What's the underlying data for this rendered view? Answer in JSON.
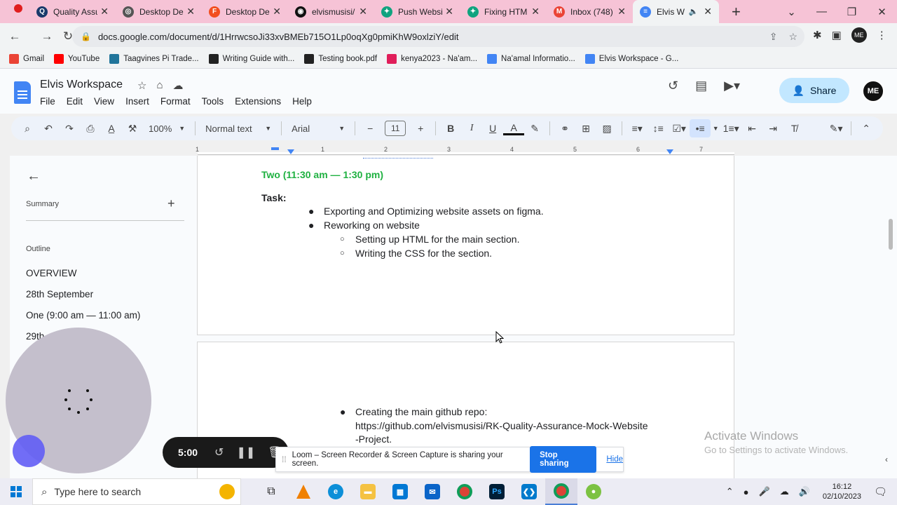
{
  "browser": {
    "tabs": [
      {
        "label": "Quality Assu",
        "color": "#1a3a6b",
        "glyph": "Q"
      },
      {
        "label": "Desktop De",
        "color": "#555",
        "glyph": "◎"
      },
      {
        "label": "Desktop De",
        "color": "#f24e1e",
        "glyph": "F"
      },
      {
        "label": "elvismusisi/",
        "color": "#111",
        "glyph": "◉"
      },
      {
        "label": "Push Websi",
        "color": "#10a37f",
        "glyph": "✦"
      },
      {
        "label": "Fixing HTM",
        "color": "#10a37f",
        "glyph": "✦"
      },
      {
        "label": "Inbox (748)",
        "color": "#ea4335",
        "glyph": "M"
      },
      {
        "label": "Elvis W",
        "color": "#4285f4",
        "glyph": "≡"
      }
    ],
    "url": "docs.google.com/document/d/1HrrwcsoJi33xvBMEb715O1Lp0oqXg0pmiKhW9oxlziY/edit",
    "bookmarks": [
      {
        "label": "Gmail",
        "color": "#ea4335"
      },
      {
        "label": "YouTube",
        "color": "#ff0000"
      },
      {
        "label": "Taagvines Pi Trade...",
        "color": "#21759b"
      },
      {
        "label": "Writing Guide with...",
        "color": "#222222"
      },
      {
        "label": "Testing book.pdf",
        "color": "#222222"
      },
      {
        "label": "kenya2023 - Na'am...",
        "color": "#e01e5a"
      },
      {
        "label": "Na'amal Informatio...",
        "color": "#4285f4"
      },
      {
        "label": "Elvis Workspace - G...",
        "color": "#4285f4"
      }
    ]
  },
  "docs": {
    "title": "Elvis Workspace",
    "menu": [
      "File",
      "Edit",
      "View",
      "Insert",
      "Format",
      "Tools",
      "Extensions",
      "Help"
    ],
    "share_label": "Share",
    "avatar_initials": "ME",
    "toolbar": {
      "zoom": "100%",
      "style": "Normal text",
      "font": "Arial",
      "font_size": "11"
    },
    "ruler_numbers": [
      "1",
      "1",
      "2",
      "3",
      "4",
      "5",
      "6",
      "7"
    ]
  },
  "outline": {
    "summary_label": "Summary",
    "outline_label": "Outline",
    "items": [
      "OVERVIEW",
      "28th September",
      "One (9:00 am — 11:00 am)",
      "29th"
    ]
  },
  "page1": {
    "heading": "Two (11:30 am — 1:30 pm)",
    "task_label": "Task:",
    "bullets": [
      "Exporting and Optimizing website assets on figma.",
      "Reworking on website"
    ],
    "sub_bullets": [
      "Setting up HTML for the main section.",
      "Writing the CSS for the section."
    ]
  },
  "page2": {
    "bullet_lines": [
      "Creating the main github repo:",
      "https://github.com/elvismusisi/RK-Quality-Assurance-Mock-Website",
      "-Project."
    ]
  },
  "loom": {
    "timer": "5:00",
    "share_message": "Loom – Screen Recorder & Screen Capture is sharing your screen.",
    "stop_label": "Stop sharing",
    "hide_label": "Hide"
  },
  "watermark": {
    "line1": "Activate Windows",
    "line2": "Go to Settings to activate Windows."
  },
  "taskbar": {
    "search_placeholder": "Type here to search",
    "time": "16:12",
    "date": "02/10/2023"
  }
}
